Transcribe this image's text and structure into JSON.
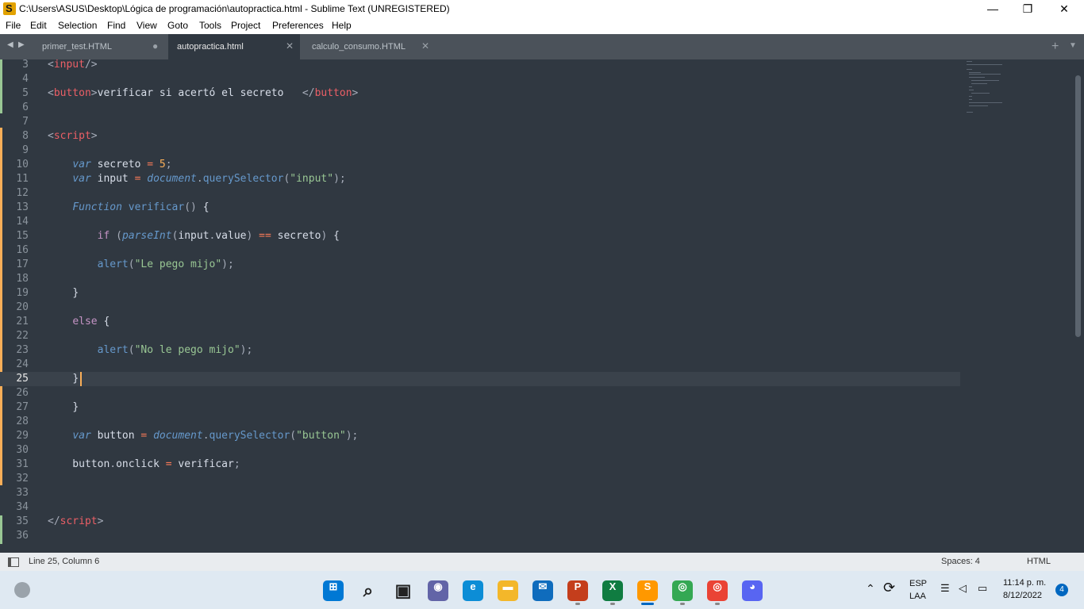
{
  "window": {
    "title": "C:\\Users\\ASUS\\Desktop\\Lógica de programación\\autopractica.html - Sublime Text (UNREGISTERED)",
    "app_icon": "S",
    "controls": {
      "minimize": "—",
      "restore": "❐",
      "close": "✕"
    }
  },
  "menu": [
    "File",
    "Edit",
    "Selection",
    "Find",
    "View",
    "Goto",
    "Tools",
    "Project",
    "Preferences",
    "Help"
  ],
  "tabs": [
    {
      "label": "primer_test.HTML",
      "control": "●",
      "active": false
    },
    {
      "label": "autopractica.html",
      "control": "✕",
      "active": true
    },
    {
      "label": "calculo_consumo.HTML",
      "control": "✕",
      "active": false
    }
  ],
  "editor": {
    "current_line": "25",
    "lines": [
      {
        "n": "3",
        "code": [
          [
            "t-pun",
            "<"
          ],
          [
            "t-tag",
            "input"
          ],
          [
            "t-pun",
            "/>"
          ]
        ]
      },
      {
        "n": "4",
        "code": []
      },
      {
        "n": "5",
        "code": [
          [
            "t-pun",
            "<"
          ],
          [
            "t-tag",
            "button"
          ],
          [
            "t-pun",
            ">"
          ],
          [
            "t-txt",
            "verificar si acertó el secreto   "
          ],
          [
            "t-pun",
            "</"
          ],
          [
            "t-tag",
            "button"
          ],
          [
            "t-pun",
            ">"
          ]
        ]
      },
      {
        "n": "6",
        "code": []
      },
      {
        "n": "7",
        "code": []
      },
      {
        "n": "8",
        "code": [
          [
            "t-pun",
            "<"
          ],
          [
            "t-tag",
            "script"
          ],
          [
            "t-pun",
            ">"
          ]
        ]
      },
      {
        "n": "9",
        "code": []
      },
      {
        "n": "10",
        "code": [
          [
            "t-txt",
            "    "
          ],
          [
            "t-ikw",
            "var"
          ],
          [
            "t-txt",
            " secreto "
          ],
          [
            "t-op",
            "="
          ],
          [
            "t-txt",
            " "
          ],
          [
            "t-num",
            "5"
          ],
          [
            "t-pun",
            ";"
          ]
        ]
      },
      {
        "n": "11",
        "code": [
          [
            "t-txt",
            "    "
          ],
          [
            "t-ikw",
            "var"
          ],
          [
            "t-txt",
            " input "
          ],
          [
            "t-op",
            "="
          ],
          [
            "t-txt",
            " "
          ],
          [
            "t-ifn",
            "document"
          ],
          [
            "t-pun",
            "."
          ],
          [
            "t-fn",
            "querySelector"
          ],
          [
            "t-pun",
            "("
          ],
          [
            "t-str",
            "\"input\""
          ],
          [
            "t-pun",
            ");"
          ]
        ]
      },
      {
        "n": "12",
        "code": []
      },
      {
        "n": "13",
        "code": [
          [
            "t-txt",
            "    "
          ],
          [
            "t-ikw",
            "Function"
          ],
          [
            "t-txt",
            " "
          ],
          [
            "t-fn",
            "verificar"
          ],
          [
            "t-pun",
            "()"
          ],
          [
            "t-txt",
            " "
          ],
          [
            "t-brace",
            "{"
          ]
        ]
      },
      {
        "n": "14",
        "code": []
      },
      {
        "n": "15",
        "code": [
          [
            "t-txt",
            "        "
          ],
          [
            "t-kw",
            "if"
          ],
          [
            "t-txt",
            " "
          ],
          [
            "t-pun",
            "("
          ],
          [
            "t-ifn",
            "parseInt"
          ],
          [
            "t-pun",
            "("
          ],
          [
            "t-txt",
            "input"
          ],
          [
            "t-pun",
            "."
          ],
          [
            "t-txt",
            "value"
          ],
          [
            "t-pun",
            ")"
          ],
          [
            "t-txt",
            " "
          ],
          [
            "t-op",
            "=="
          ],
          [
            "t-txt",
            " secreto"
          ],
          [
            "t-pun",
            ")"
          ],
          [
            "t-txt",
            " "
          ],
          [
            "t-brace",
            "{"
          ]
        ]
      },
      {
        "n": "16",
        "code": []
      },
      {
        "n": "17",
        "code": [
          [
            "t-txt",
            "        "
          ],
          [
            "t-fn",
            "alert"
          ],
          [
            "t-pun",
            "("
          ],
          [
            "t-str",
            "\"Le pego mijo\""
          ],
          [
            "t-pun",
            ");"
          ]
        ]
      },
      {
        "n": "18",
        "code": []
      },
      {
        "n": "19",
        "code": [
          [
            "t-txt",
            "    "
          ],
          [
            "t-brace",
            "}"
          ]
        ]
      },
      {
        "n": "20",
        "code": []
      },
      {
        "n": "21",
        "code": [
          [
            "t-txt",
            "    "
          ],
          [
            "t-kw",
            "else"
          ],
          [
            "t-txt",
            " "
          ],
          [
            "t-brace",
            "{"
          ]
        ]
      },
      {
        "n": "22",
        "code": []
      },
      {
        "n": "23",
        "code": [
          [
            "t-txt",
            "        "
          ],
          [
            "t-fn",
            "alert"
          ],
          [
            "t-pun",
            "("
          ],
          [
            "t-str",
            "\"No le pego mijo\""
          ],
          [
            "t-pun",
            ");"
          ]
        ]
      },
      {
        "n": "24",
        "code": []
      },
      {
        "n": "25",
        "code": [
          [
            "t-txt",
            "    "
          ],
          [
            "t-brace",
            "}"
          ]
        ]
      },
      {
        "n": "26",
        "code": []
      },
      {
        "n": "27",
        "code": [
          [
            "t-txt",
            "    "
          ],
          [
            "t-brace",
            "}"
          ]
        ]
      },
      {
        "n": "28",
        "code": []
      },
      {
        "n": "29",
        "code": [
          [
            "t-txt",
            "    "
          ],
          [
            "t-ikw",
            "var"
          ],
          [
            "t-txt",
            " button "
          ],
          [
            "t-op",
            "="
          ],
          [
            "t-txt",
            " "
          ],
          [
            "t-ifn",
            "document"
          ],
          [
            "t-pun",
            "."
          ],
          [
            "t-fn",
            "querySelector"
          ],
          [
            "t-pun",
            "("
          ],
          [
            "t-str",
            "\"button\""
          ],
          [
            "t-pun",
            ");"
          ]
        ]
      },
      {
        "n": "30",
        "code": []
      },
      {
        "n": "31",
        "code": [
          [
            "t-txt",
            "    button"
          ],
          [
            "t-pun",
            "."
          ],
          [
            "t-txt",
            "onclick "
          ],
          [
            "t-op",
            "="
          ],
          [
            "t-txt",
            " verificar"
          ],
          [
            "t-pun",
            ";"
          ]
        ]
      },
      {
        "n": "32",
        "code": []
      },
      {
        "n": "33",
        "code": []
      },
      {
        "n": "34",
        "code": []
      },
      {
        "n": "35",
        "code": [
          [
            "t-pun",
            "</"
          ],
          [
            "t-tag",
            "script"
          ],
          [
            "t-pun",
            ">"
          ]
        ]
      },
      {
        "n": "36",
        "code": []
      }
    ]
  },
  "status": {
    "position": "Line 25, Column 6",
    "indent": "Spaces: 4",
    "syntax": "HTML"
  },
  "taskbar": {
    "apps": [
      {
        "name": "start-icon",
        "glyph": "⊞",
        "color": "#0078d4",
        "active": false
      },
      {
        "name": "search-icon",
        "glyph": "⌕",
        "color": "#222222",
        "active": false
      },
      {
        "name": "task-view-icon",
        "glyph": "▣",
        "color": "#222222",
        "active": false
      },
      {
        "name": "chat-icon",
        "glyph": "◉",
        "color": "#6264a7",
        "active": false
      },
      {
        "name": "edge-icon",
        "glyph": "e",
        "color": "#0c8dd6",
        "active": false
      },
      {
        "name": "file-explorer-icon",
        "glyph": "▬",
        "color": "#f3b72a",
        "active": false
      },
      {
        "name": "mail-icon",
        "glyph": "✉",
        "color": "#0f6cbd",
        "active": false
      },
      {
        "name": "powerpoint-icon",
        "glyph": "P",
        "color": "#c43e1c",
        "active": true
      },
      {
        "name": "excel-icon",
        "glyph": "X",
        "color": "#107c41",
        "active": true
      },
      {
        "name": "sublime-text-icon",
        "glyph": "S",
        "color": "#ff9800",
        "active": true
      },
      {
        "name": "chrome-profile-1-icon",
        "glyph": "◎",
        "color": "#34a853",
        "active": true
      },
      {
        "name": "chrome-profile-2-icon",
        "glyph": "◎",
        "color": "#ea4335",
        "active": true
      },
      {
        "name": "discord-icon",
        "glyph": "◕",
        "color": "#5865f2",
        "active": false
      }
    ],
    "tray": {
      "language_top": "ESP",
      "language_bottom": "LAA",
      "time": "11:14 p. m.",
      "date": "8/12/2022",
      "notifications": "4"
    }
  }
}
